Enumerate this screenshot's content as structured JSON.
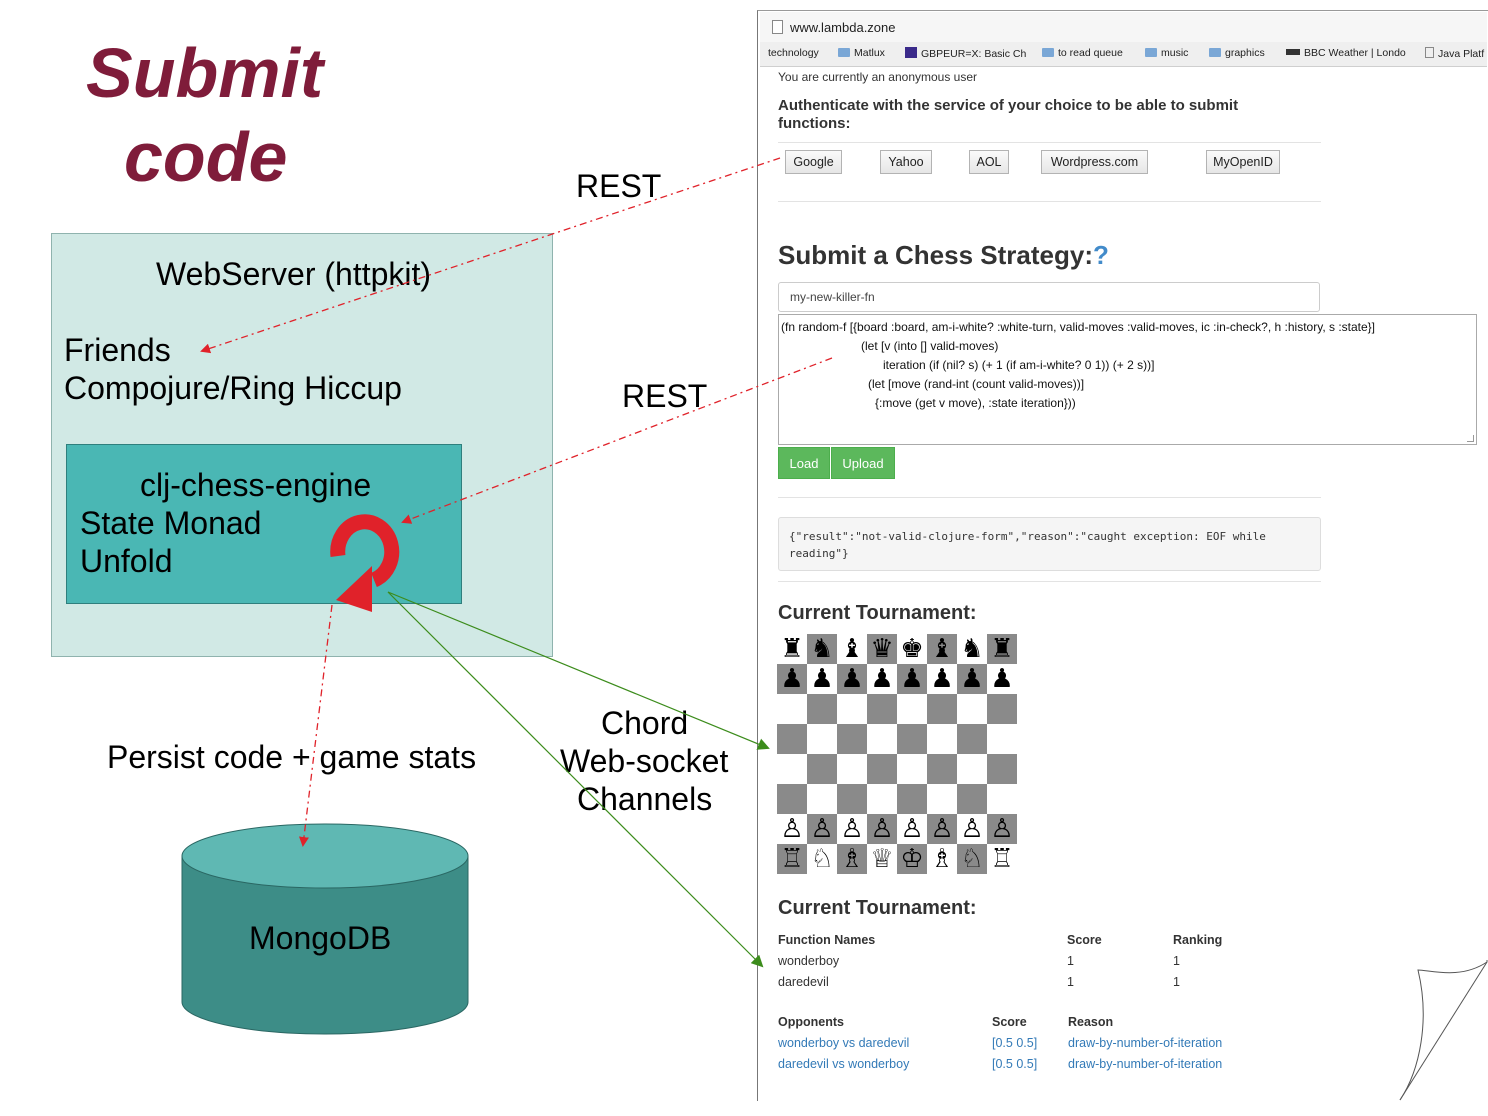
{
  "slide": {
    "title_line1": "Submit",
    "title_line2": "code",
    "rest_label_top": "REST",
    "rest_label_mid": "REST",
    "webserver_title": "WebServer (httpkit)",
    "friends": "Friends",
    "compojure": "Compojure/Ring Hiccup",
    "engine_title": "clj-chess-engine",
    "engine_line2": "State Monad",
    "engine_line3": "Unfold",
    "persist_label": "Persist code + game stats",
    "db_label": "MongoDB",
    "chord_line1": "Chord",
    "chord_line2": "Web-socket",
    "chord_line3": "Channels",
    "colors": {
      "title": "#7f1c3a",
      "webserver_bg": "#d1e9e5",
      "engine_bg": "#4ab7b4",
      "db": "#3d8d87",
      "rest_arrow": "#e0222a",
      "ws_arrow": "#3c8c1c"
    }
  },
  "browser": {
    "url": "www.lambda.zone",
    "bookmarks": [
      "technology",
      "Matlux",
      "GBPEUR=X: Basic Ch",
      "to read queue",
      "music",
      "graphics",
      "BBC Weather | Londo",
      "Java Platf"
    ],
    "anon_notice": "You are currently an anonymous user",
    "auth_prompt_line1": "Authenticate with the service of your choice to be able to submit",
    "auth_prompt_line2": "functions:",
    "auth_buttons": [
      "Google",
      "Yahoo",
      "AOL",
      "Wordpress.com",
      "MyOpenID"
    ],
    "submit_heading": "Submit a Chess Strategy:",
    "help_mark": "?",
    "fn_name_value": "my-new-killer-fn",
    "code_lines": [
      "(fn random-f [{board :board, am-i-white? :white-turn, valid-moves :valid-moves, ic :in-check?, h :history, s :state}]",
      "(let [v (into [] valid-moves)",
      "iteration (if (nil? s) (+ 1 (if am-i-white? 0 1)) (+ 2 s))]",
      "(let [move (rand-int (count valid-moves))]",
      "{:move (get v move), :state iteration}))"
    ],
    "load_button": "Load",
    "upload_button": "Upload",
    "result_line1": "{\"result\":\"not-valid-clojure-form\",\"reason\":\"caught exception: EOF while",
    "result_line2": "reading\"}",
    "tournament_heading_1": "Current Tournament:",
    "tournament_heading_2": "Current Tournament:",
    "standings_headers": [
      "Function Names",
      "Score",
      "Ranking"
    ],
    "standings_rows": [
      [
        "wonderboy",
        "1",
        "1"
      ],
      [
        "daredevil",
        "1",
        "1"
      ]
    ],
    "games_headers": [
      "Opponents",
      "Score",
      "Reason"
    ],
    "games_rows": [
      [
        "wonderboy vs daredevil",
        "[0.5 0.5]",
        "draw-by-number-of-iteration"
      ],
      [
        "daredevil vs wonderboy",
        "[0.5 0.5]",
        "draw-by-number-of-iteration"
      ]
    ]
  },
  "board": {
    "ranks": [
      "rnbqkbnr",
      "pppppppp",
      "........",
      "........",
      "........",
      "........",
      "PPPPPPPP",
      "RNBQKBNR"
    ],
    "glyphs": {
      "k": "♚",
      "q": "♛",
      "r": "♜",
      "b": "♝",
      "n": "♞",
      "p": "♟",
      "K": "♔",
      "Q": "♕",
      "R": "♖",
      "B": "♗",
      "N": "♘",
      "P": "♙"
    }
  }
}
